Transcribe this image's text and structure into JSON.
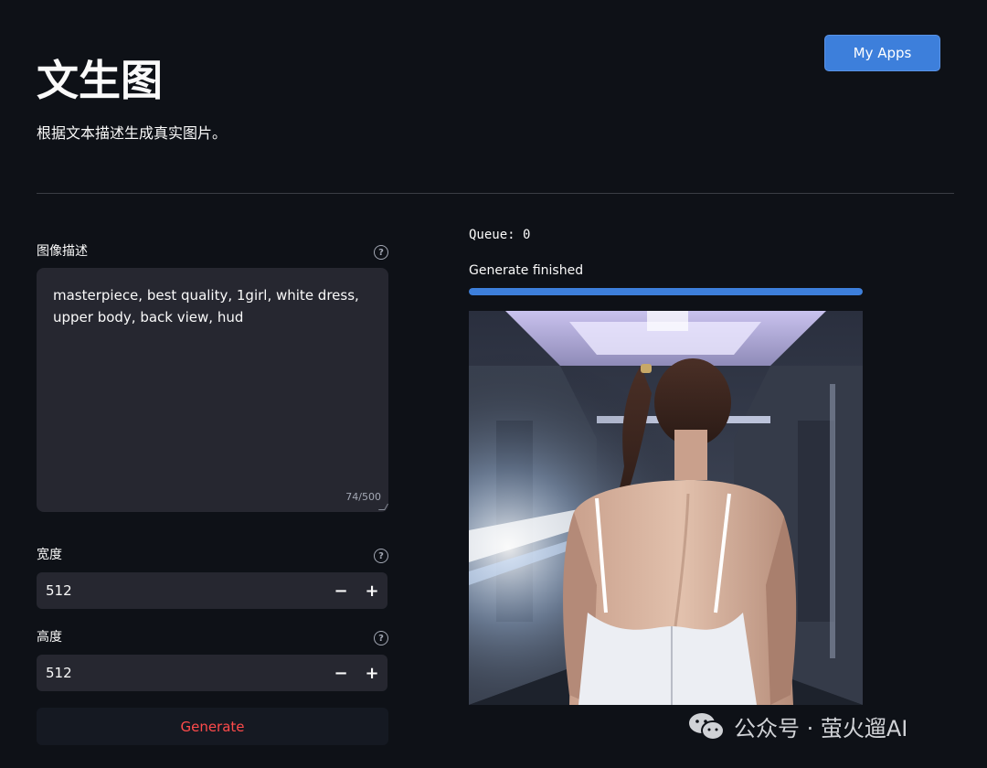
{
  "header": {
    "title": "文生图",
    "subtitle": "根据文本描述生成真实图片。",
    "my_apps_label": "My Apps"
  },
  "form": {
    "prompt_label": "图像描述",
    "prompt_value": "masterpiece, best quality,  1girl, white dress, upper body, back view, hud",
    "char_count": "74/500",
    "width_label": "宽度",
    "width_value": "512",
    "height_label": "高度",
    "height_value": "512",
    "minus": "−",
    "plus": "+",
    "help": "?",
    "generate_label": "Generate"
  },
  "output": {
    "queue_text": "Queue: 0",
    "status_text": "Generate finished",
    "progress": 1.0
  },
  "watermark": {
    "text": "公众号 · 萤火遛AI",
    "icon": "wechat-icon"
  },
  "colors": {
    "background": "#0e1117",
    "accent": "#3d7fdb",
    "generate_text": "#ff4b4b",
    "input_bg": "#262730"
  }
}
